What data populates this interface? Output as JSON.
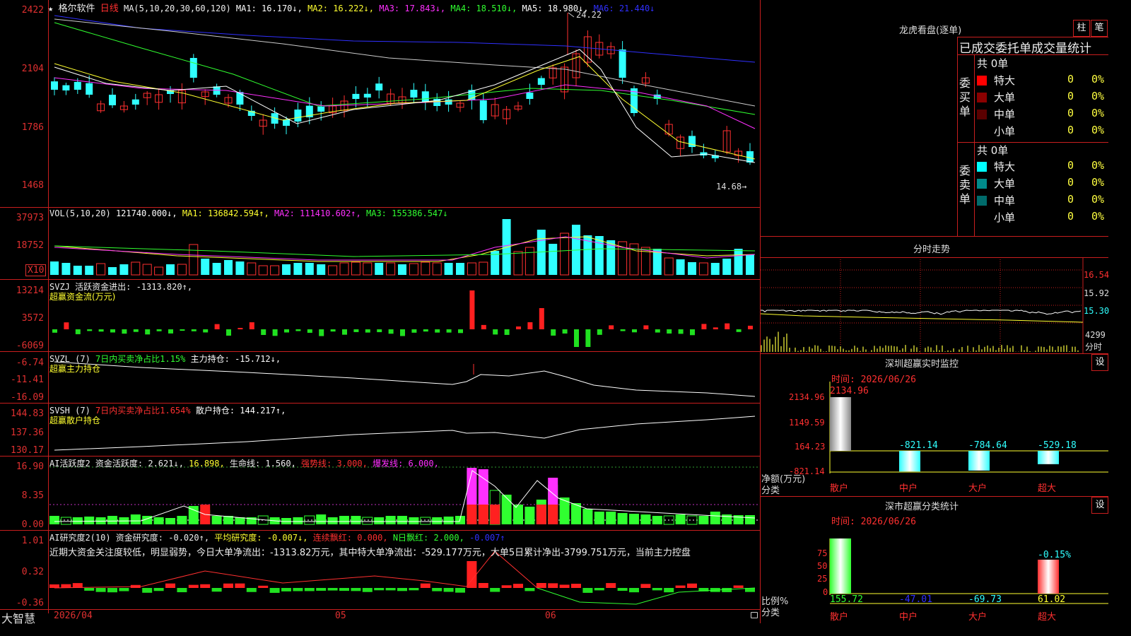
{
  "app": {
    "brand": "大智慧"
  },
  "kline": {
    "stock_name": "格尔软件",
    "period": "日线",
    "ma_head": "MA(5,10,20,30,60,120)",
    "ma1": "MA1: 16.170↓,",
    "ma2": "MA2: 16.222↓,",
    "ma3": "MA3: 17.843↓,",
    "ma4": "MA4: 18.510↓,",
    "ma5": "MA5: 18.980↓,",
    "ma6": "MA6: 21.440↓",
    "high_mark": "24.22",
    "low_mark": "14.68→",
    "y_labels": [
      "2422",
      "2104",
      "1786",
      "1468"
    ]
  },
  "vol": {
    "head": "VOL(5,10,20)",
    "val": "121740.000↓,",
    "ma1": "MA1: 136842.594↑,",
    "ma2": "MA2: 111410.602↑,",
    "ma3": "MA3: 155386.547↓",
    "y_labels": [
      "37973",
      "18752"
    ],
    "unit": "X10"
  },
  "svzj": {
    "head": "SVZJ  活跃资金进出: -1313.820↑,",
    "sub": "超赢资金流(万元)",
    "y_labels": [
      "13214",
      "3572",
      "-6069"
    ]
  },
  "svzl": {
    "head1": "SVZL (7)",
    "head2": "7日内买卖净占比1.15%",
    "head3": "主力持仓: -15.712↓,",
    "sub": "超赢主力持仓",
    "y_labels": [
      "-6.74",
      "-11.41",
      "-16.09"
    ]
  },
  "svsh": {
    "head1": "SVSH (7)",
    "head2": "7日内买卖净占比1.654%",
    "head3": "散户持仓: 144.217↑,",
    "sub": "超赢散户持仓",
    "y_labels": [
      "144.83",
      "137.36",
      "130.17"
    ]
  },
  "ai_active": {
    "head1": "AI活跃度2 资金活跃度: 2.621↓,",
    "head2": "16.898,",
    "head3": "生命线: 1.560,",
    "head4": "强势线: 3.000,",
    "head5": "爆发线: 6.000,",
    "y_labels": [
      "16.90",
      "8.35",
      "0.00"
    ]
  },
  "ai_research": {
    "head1": "AI研究度2(10) 资金研究度: -0.020↑,",
    "head2": "平均研究度: -0.007↓,",
    "head3": "连续飘红: 0.000,",
    "head4": "N日飘红: 2.000,",
    "head5": "-0.007↑",
    "note": "近期大资金关注度较低，明显弱势，今日大单净流出：-1313.82万元，其中特大单净流出：-529.177万元，大单5日累计净出-3799.751万元，当前主力控盘",
    "y_labels": [
      "1.01",
      "0.32",
      "-0.36"
    ]
  },
  "x_axis": {
    "labels": [
      "2026/04",
      "05",
      "06"
    ]
  },
  "dragon_tiger": {
    "title": "龙虎看盘(逐单)",
    "btn_bar": "柱",
    "btn_pen": "笔",
    "tabs": [
      "已成交",
      "委托单",
      "成交量统计"
    ],
    "buy": {
      "side_label": "委买单",
      "total": "共 0单",
      "rows": [
        {
          "name": "特大",
          "count": "0",
          "pct": "0%",
          "color": "#ff0000"
        },
        {
          "name": "大单",
          "count": "0",
          "pct": "0%",
          "color": "#8b0000"
        },
        {
          "name": "中单",
          "count": "0",
          "pct": "0%",
          "color": "#5a0000"
        },
        {
          "name": "小单",
          "count": "0",
          "pct": "0%",
          "color": "#000000"
        }
      ]
    },
    "sell": {
      "side_label": "委卖单",
      "total": "共 0单",
      "rows": [
        {
          "name": "特大",
          "count": "0",
          "pct": "0%",
          "color": "#00ffff"
        },
        {
          "name": "大单",
          "count": "0",
          "pct": "0%",
          "color": "#008b8b"
        },
        {
          "name": "中单",
          "count": "0",
          "pct": "0%",
          "color": "#006b6b"
        },
        {
          "name": "小单",
          "count": "0",
          "pct": "0%",
          "color": "#000000"
        }
      ]
    }
  },
  "intraday": {
    "title": "分时走势",
    "y_labels": [
      "16.54",
      "15.92",
      "15.30"
    ],
    "vol_label": "4299",
    "vol_unit": "分时"
  },
  "sz_monitor": {
    "title": "深圳超赢实时监控",
    "btn": "设",
    "time": "时间: 2026/06/26",
    "y_labels": [
      "2134.96",
      "1149.59",
      "164.23",
      "-821.14"
    ],
    "bar_values": [
      "2134.96",
      "-821.14",
      "-784.64",
      "-529.18"
    ],
    "categories": [
      "散户",
      "中户",
      "大户",
      "超大"
    ],
    "y_title": "净额(万元)",
    "x_title": "分类"
  },
  "sz_stats": {
    "title": "深市超赢分类统计",
    "btn": "设",
    "time": "时间: 2026/06/26",
    "y_labels": [
      "75",
      "50",
      "25",
      "0"
    ],
    "bar_label": "-0.15%",
    "values": [
      "155.72",
      "-47.01",
      "-69.73",
      "61.02"
    ],
    "categories": [
      "散户",
      "中户",
      "大户",
      "超大"
    ],
    "y_title": "比例%",
    "x_title": "分类"
  },
  "chart_data": [
    {
      "type": "bar",
      "title": "深圳超赢实时监控",
      "ylabel": "净额(万元)",
      "xlabel": "分类",
      "categories": [
        "散户",
        "中户",
        "大户",
        "超大"
      ],
      "values": [
        2134.96,
        -821.14,
        -784.64,
        -529.18
      ],
      "ylim": [
        -821.14,
        2134.96
      ]
    },
    {
      "type": "bar",
      "title": "深市超赢分类统计",
      "ylabel": "比例%",
      "xlabel": "分类",
      "categories": [
        "散户",
        "中户",
        "大户",
        "超大"
      ],
      "values": [
        155.72,
        -47.01,
        -69.73,
        61.02
      ],
      "ylim": [
        0,
        75
      ]
    }
  ]
}
